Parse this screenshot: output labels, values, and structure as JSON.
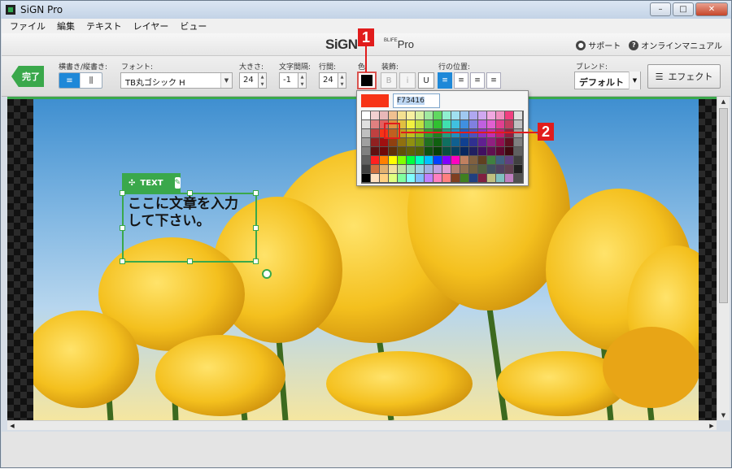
{
  "window": {
    "title": "SiGN Pro",
    "buttons": [
      "–",
      "□",
      "✕"
    ]
  },
  "menu": [
    "ファイル",
    "編集",
    "テキスト",
    "レイヤー",
    "ビュー"
  ],
  "brand": {
    "name": "SiGN",
    "tail_sup": "BLIFE",
    "tail": "Pro"
  },
  "help": {
    "support": "サポート",
    "manual": "オンラインマニュアル"
  },
  "toolbar": {
    "done": "完了",
    "orientation_label": "横書き/縦書き:",
    "orientation_options": [
      "≡",
      "⫼"
    ],
    "font_label": "フォント:",
    "font_value": "TB丸ゴシック H",
    "size_label": "大きさ:",
    "size_value": "24",
    "spacing_label": "文字間隔:",
    "spacing_value": "-1",
    "line_label": "行間:",
    "line_value": "24",
    "color_label": "色:",
    "color_value": "#000000",
    "deco_label": "装飾:",
    "deco": [
      "B",
      "i",
      "U"
    ],
    "line_pos_label": "行の位置:",
    "blend_label": "ブレンド:",
    "blend_value": "デフォルト",
    "effect": "エフェクト"
  },
  "canvas": {
    "text_tab": "TEXT",
    "text_line1": "ここに文章を入力",
    "text_line2": "して下さい。"
  },
  "palette": {
    "current_color": "#F73416",
    "hex_value": "F73416"
  },
  "callouts": [
    "1",
    "2"
  ]
}
